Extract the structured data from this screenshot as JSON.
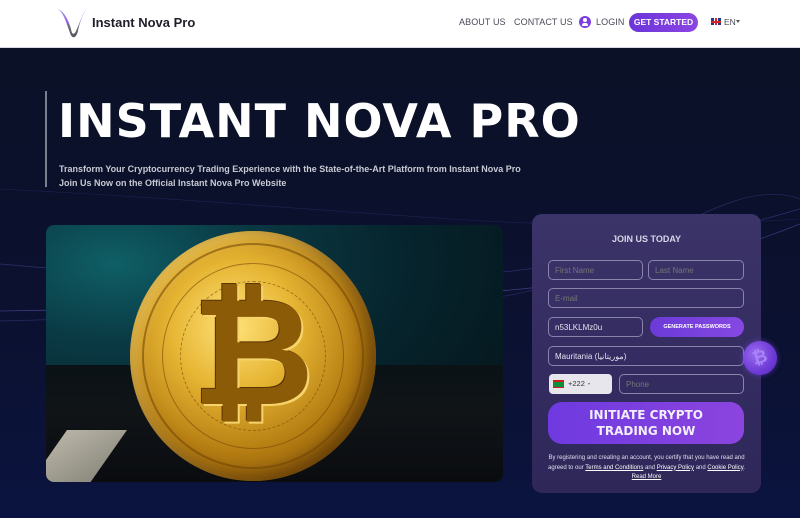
{
  "header": {
    "brand": "Instant Nova Pro",
    "nav": {
      "about": "ABOUT US",
      "contact": "CONTACT US",
      "login": "LOGIN",
      "get_started": "GET STARTED",
      "language": "EN"
    }
  },
  "hero": {
    "title": "INSTANT NOVA PRO",
    "subtitle_line1": "Transform Your Cryptocurrency Trading Experience with the State-of-the-Art Platform from Instant Nova Pro",
    "subtitle_line2": "Join Us Now on the Official Instant Nova Pro Website",
    "coin_symbol": "₿"
  },
  "form": {
    "title": "JOIN US TODAY",
    "first_name_placeholder": "First Name",
    "last_name_placeholder": "Last Name",
    "email_placeholder": "E-mail",
    "password_value": "n53LKLMz0u",
    "generate_label": "GENERATE PASSWORDS",
    "country_value": "Mauritania (موريتانيا)",
    "phone_code": "+222",
    "phone_placeholder": "Phone",
    "submit_label": "INITIATE CRYPTO TRADING NOW",
    "legal": {
      "text_before": "By registering and creating an account, you certify that you have read and agreed to our ",
      "terms": "Terms and Conditions",
      "and1": " and ",
      "privacy": "Privacy Policy",
      "and2": " and ",
      "cookie": "Cookie Policy",
      "sep": ". ",
      "read_more": "Read More"
    }
  },
  "colors": {
    "accent": "#7b3fe0",
    "background": "#0b1026",
    "form_bg": "#352d62"
  }
}
